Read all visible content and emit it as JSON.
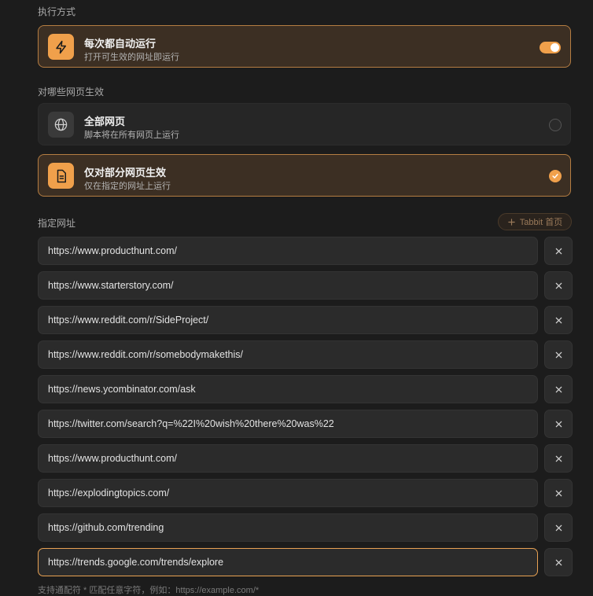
{
  "execution": {
    "section_label": "执行方式",
    "auto_run": {
      "title": "每次都自动运行",
      "subtitle": "打开可生效的网址即运行",
      "enabled": true
    }
  },
  "scope": {
    "section_label": "对哪些网页生效",
    "options": [
      {
        "title": "全部网页",
        "subtitle": "脚本将在所有网页上运行",
        "selected": false,
        "icon": "globe-icon"
      },
      {
        "title": "仅对部分网页生效",
        "subtitle": "仅在指定的网址上运行",
        "selected": true,
        "icon": "document-icon"
      }
    ]
  },
  "urls": {
    "section_label": "指定网址",
    "add_button_label": "Tabbit 首页",
    "items": [
      "https://www.producthunt.com/",
      "https://www.starterstory.com/",
      "https://www.reddit.com/r/SideProject/",
      "https://www.reddit.com/r/somebodymakethis/",
      "https://news.ycombinator.com/ask",
      "https://twitter.com/search?q=%22I%20wish%20there%20was%22",
      "https://www.producthunt.com/",
      "https://explodingtopics.com/",
      "https://github.com/trending",
      "https://trends.google.com/trends/explore"
    ],
    "focused_index": 9,
    "hint": "支持通配符 * 匹配任意字符，例如：https://example.com/*"
  },
  "colors": {
    "accent": "#f0a04b",
    "background": "#1c1c1c"
  }
}
